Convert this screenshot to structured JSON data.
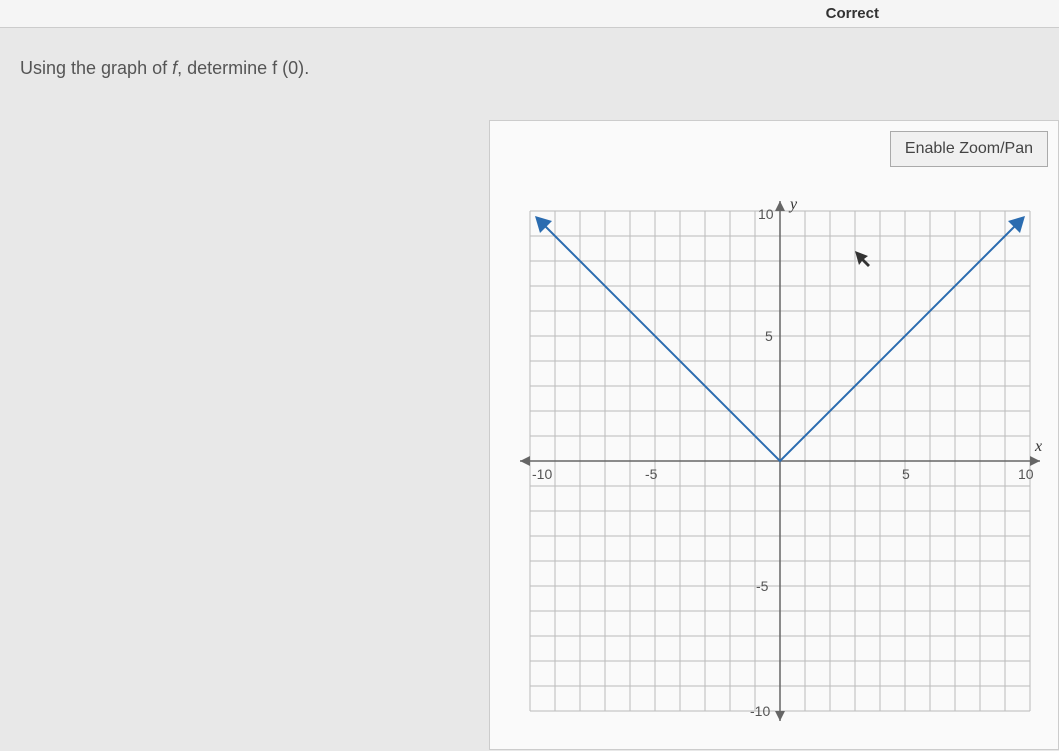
{
  "header": {
    "status": "Correct"
  },
  "question": {
    "prefix": "Using the graph of ",
    "fn": "f",
    "middle": ", determine ",
    "expr": "f (0)",
    "suffix": "."
  },
  "controls": {
    "zoom": "Enable Zoom/Pan"
  },
  "chart_data": {
    "type": "line",
    "title": "",
    "xlabel": "x",
    "ylabel": "y",
    "xlim": [
      -10,
      10
    ],
    "ylim": [
      -10,
      10
    ],
    "x_ticks": [
      -10,
      -5,
      5,
      10
    ],
    "y_ticks": [
      -10,
      -5,
      5,
      10
    ],
    "series": [
      {
        "name": "f",
        "x": [
          -10,
          0,
          10
        ],
        "y": [
          10,
          0,
          10
        ]
      }
    ],
    "tick_labels": {
      "x_neg10": "-10",
      "x_neg5": "-5",
      "x_5": "5",
      "x_10": "10",
      "y_neg10": "-10",
      "y_neg5": "-5",
      "y_5": "5",
      "y_10": "10"
    }
  }
}
